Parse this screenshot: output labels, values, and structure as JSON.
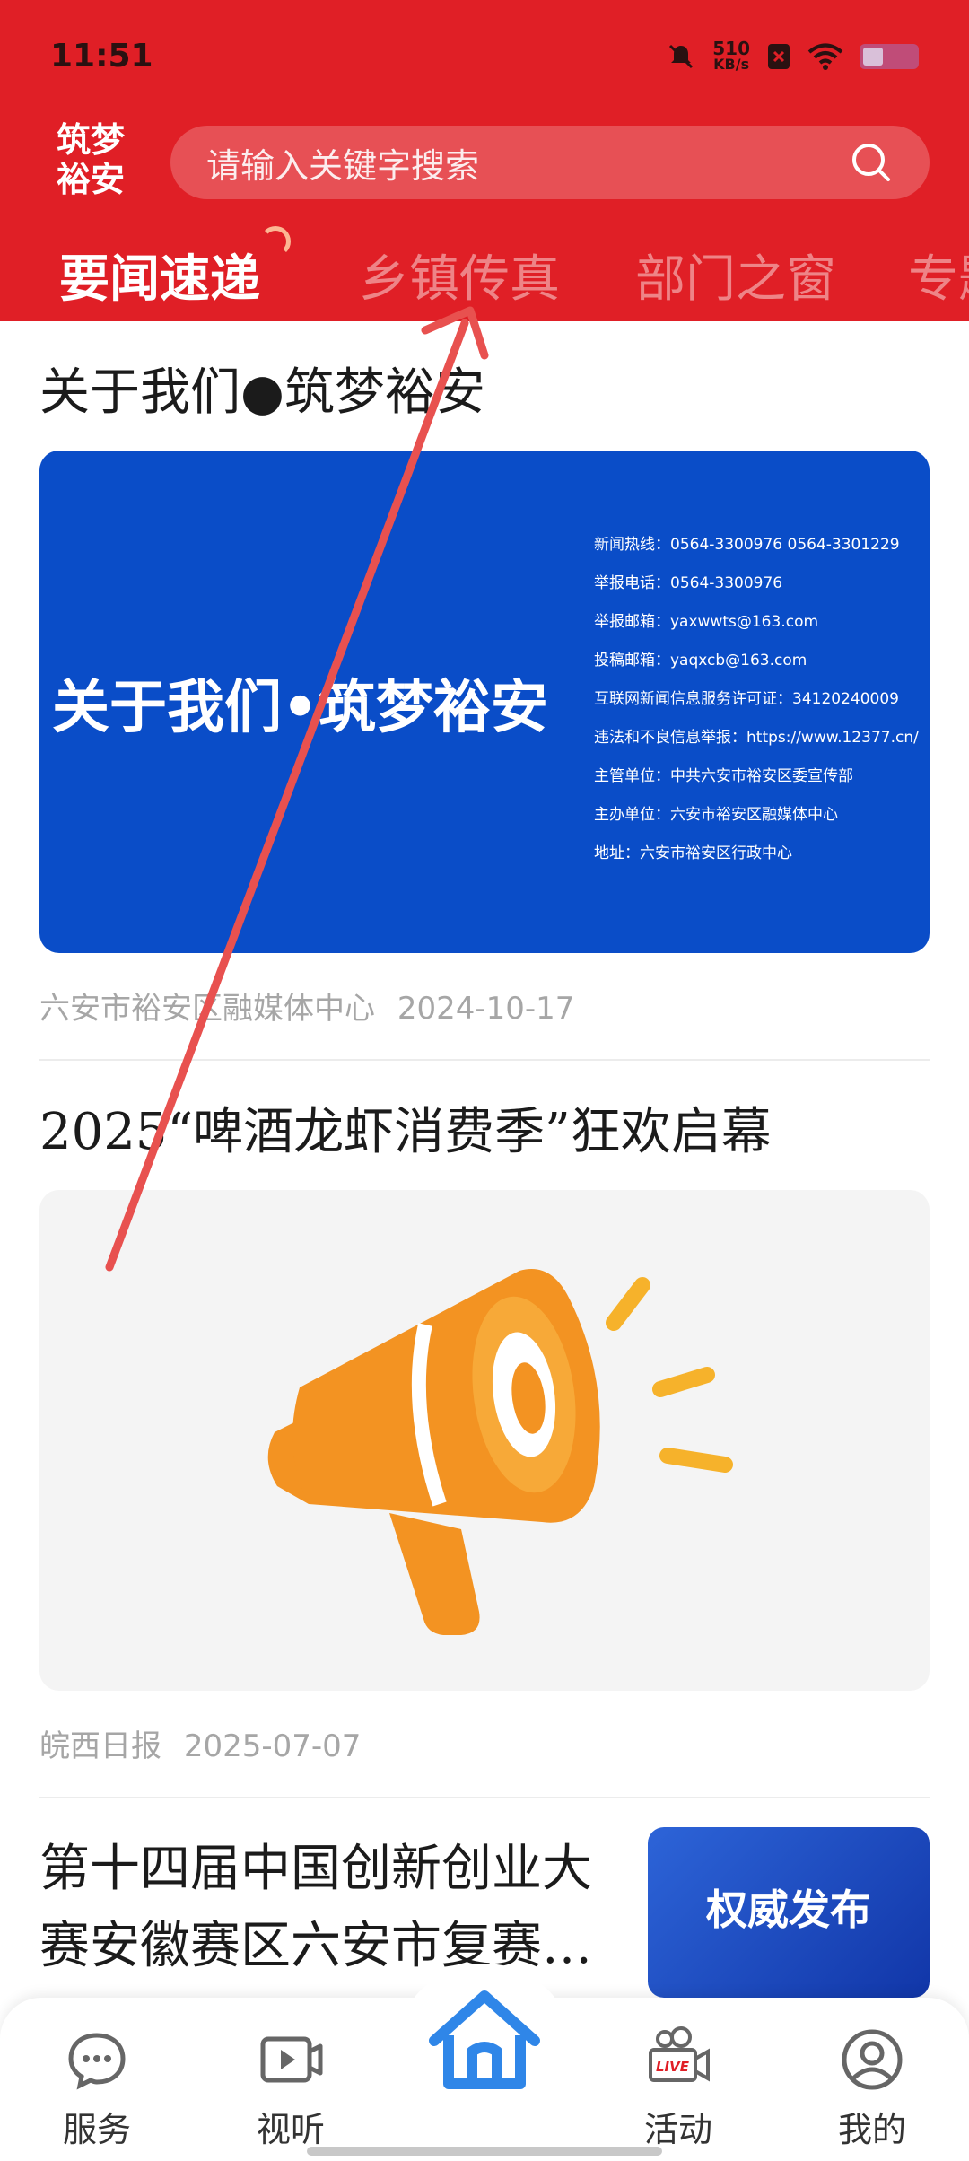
{
  "status_bar": {
    "time": "11:51",
    "net_speed_value": "510",
    "net_speed_unit": "KB/s"
  },
  "header": {
    "logo_text_line1": "筑梦",
    "logo_text_line2": "裕安",
    "search_placeholder": "请输入关键字搜索"
  },
  "tabs": [
    {
      "label": "要闻速递",
      "active": true
    },
    {
      "label": "乡镇传真",
      "active": false
    },
    {
      "label": "部门之窗",
      "active": false
    },
    {
      "label": "专题",
      "active": false
    }
  ],
  "articles": [
    {
      "title": "关于我们●筑梦裕安",
      "banner_headline": "关于我们•筑梦裕安",
      "info_lines": [
        "新闻热线：0564-3300976  0564-3301229",
        "举报电话：0564-3300976",
        "举报邮箱：yaxwwts@163.com",
        "投稿邮箱：yaqxcb@163.com",
        "互联网新闻信息服务许可证：34120240009",
        "违法和不良信息举报：https://www.12377.cn/",
        "主管单位：中共六安市裕安区委宣传部",
        "主办单位：六安市裕安区融媒体中心",
        "地址：六安市裕安区行政中心"
      ],
      "source": "六安市裕安区融媒体中心",
      "date": "2024-10-17"
    },
    {
      "title": "2025“啤酒龙虾消费季”狂欢启幕",
      "source": "皖西日报",
      "date": "2025-07-07"
    },
    {
      "title_line1": "第十四届中国创新创业大",
      "title_line2": "赛安徽赛区六安市复赛…",
      "thumb_text": "权威发布"
    }
  ],
  "bottom_nav": [
    {
      "label": "服务",
      "icon": "chat-bubble-icon"
    },
    {
      "label": "视听",
      "icon": "video-play-icon"
    },
    {
      "label": "",
      "icon": "home-icon"
    },
    {
      "label": "活动",
      "icon": "live-camera-icon"
    },
    {
      "label": "我的",
      "icon": "user-icon"
    }
  ],
  "colors": {
    "brand_red": "#e01f26",
    "banner_blue": "#0a4dc8",
    "accent_blue": "#2f86e8",
    "megaphone_orange": "#f39322",
    "annotation_arrow": "#e8514f"
  }
}
